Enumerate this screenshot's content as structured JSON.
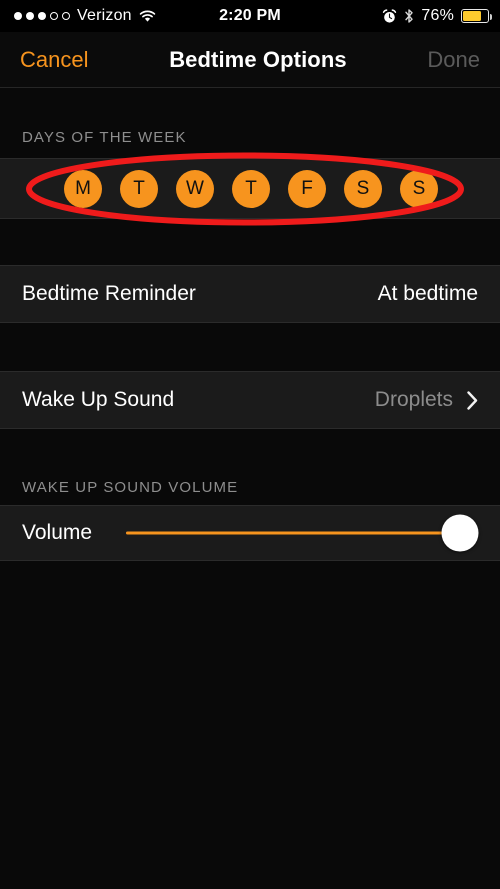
{
  "status_bar": {
    "signal_dots_filled": 3,
    "signal_dots_total": 5,
    "carrier": "Verizon",
    "wifi_icon": "wifi-icon",
    "time": "2:20 PM",
    "alarm_icon": "alarm-clock-icon",
    "bluetooth_icon": "bluetooth-icon",
    "battery_percent": "76%",
    "battery_level": 76,
    "battery_color": "#fecb2e"
  },
  "nav": {
    "cancel_label": "Cancel",
    "title": "Bedtime Options",
    "done_label": "Done"
  },
  "sections": {
    "days": {
      "header": "DAYS OF THE WEEK",
      "days": [
        {
          "letter": "M",
          "name": "monday",
          "selected": true
        },
        {
          "letter": "T",
          "name": "tuesday",
          "selected": true
        },
        {
          "letter": "W",
          "name": "wednesday",
          "selected": true
        },
        {
          "letter": "T",
          "name": "thursday",
          "selected": true
        },
        {
          "letter": "F",
          "name": "friday",
          "selected": true
        },
        {
          "letter": "S",
          "name": "saturday",
          "selected": true
        },
        {
          "letter": "S",
          "name": "sunday",
          "selected": true
        }
      ]
    },
    "reminder": {
      "label": "Bedtime Reminder",
      "value": "At bedtime"
    },
    "wake_up_sound": {
      "label": "Wake Up Sound",
      "value": "Droplets",
      "chevron_icon": "chevron-right-icon"
    },
    "volume": {
      "header": "WAKE UP SOUND VOLUME",
      "label": "Volume",
      "value_percent": 100
    }
  },
  "colors": {
    "accent_orange": "#f7941e",
    "day_circle": "#f7941e",
    "annotation_red": "#ef1b1b",
    "row_background": "#1b1b1b",
    "page_background": "#090909"
  },
  "annotation": {
    "shape": "ellipse",
    "target": "days-of-the-week-row",
    "color": "#ef1b1b"
  }
}
